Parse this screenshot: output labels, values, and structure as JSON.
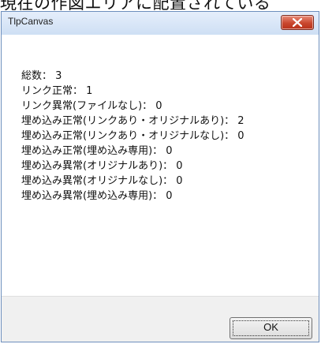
{
  "backdrop": {
    "text": "現在の作図エリアに配置されている"
  },
  "window": {
    "title": "TlpCanvas",
    "close_icon": "close-icon"
  },
  "message": {
    "lines": [
      "総数： 3",
      "リンク正常： 1",
      "リンク異常(ファイルなし)： 0",
      "埋め込み正常(リンクあり・オリジナルあり)： 2",
      "埋め込み正常(リンクあり・オリジナルなし)： 0",
      "埋め込み正常(埋め込み専用)： 0",
      "埋め込み異常(オリジナルあり)： 0",
      "埋め込み異常(オリジナルなし)： 0",
      "埋め込み異常(埋め込み専用)： 0"
    ]
  },
  "buttons": {
    "ok_label": "OK"
  },
  "colors": {
    "close_button": "#c9472e",
    "titlebar": "#dbe6f6"
  }
}
